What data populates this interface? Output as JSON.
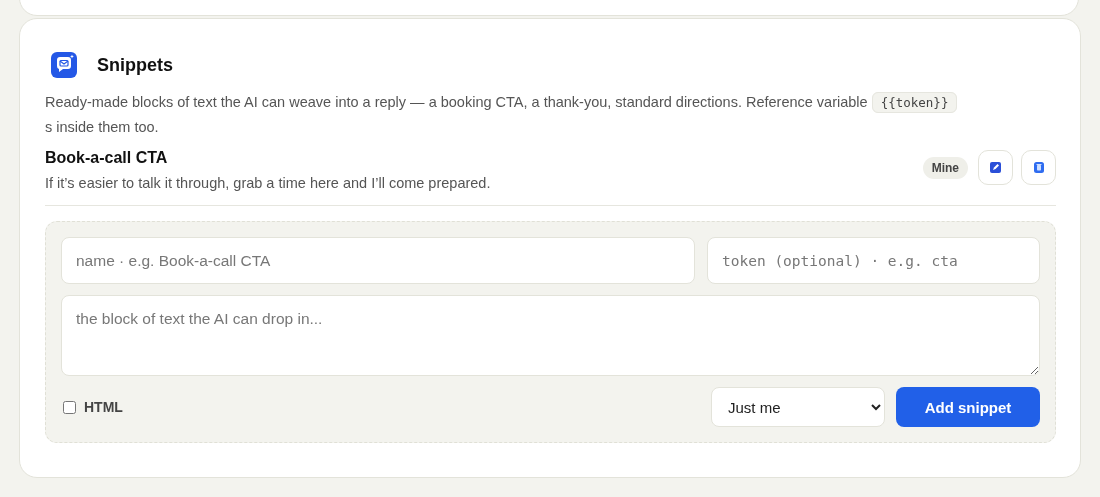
{
  "section": {
    "title": "Snippets",
    "description": {
      "before": "Ready-made blocks of text the AI can weave into a reply — a booking CTA, a thank-you, standard directions. Reference variable",
      "token": "{{token}}",
      "after": "s inside them too."
    }
  },
  "snippets": [
    {
      "title": "Book-a-call CTA",
      "text": "If it’s easier to talk it through, grab a time here and I’ll come prepared.",
      "badge": "Mine"
    }
  ],
  "form": {
    "name": {
      "placeholder": "name · e.g. Book-a-call CTA"
    },
    "token": {
      "placeholder": "token (optional) · e.g. cta"
    },
    "body": {
      "placeholder": "the block of text the AI can drop in..."
    },
    "html": {
      "label": "HTML",
      "checked": false
    },
    "visibility": {
      "value": "Just me"
    },
    "submit": "Add snippet"
  }
}
